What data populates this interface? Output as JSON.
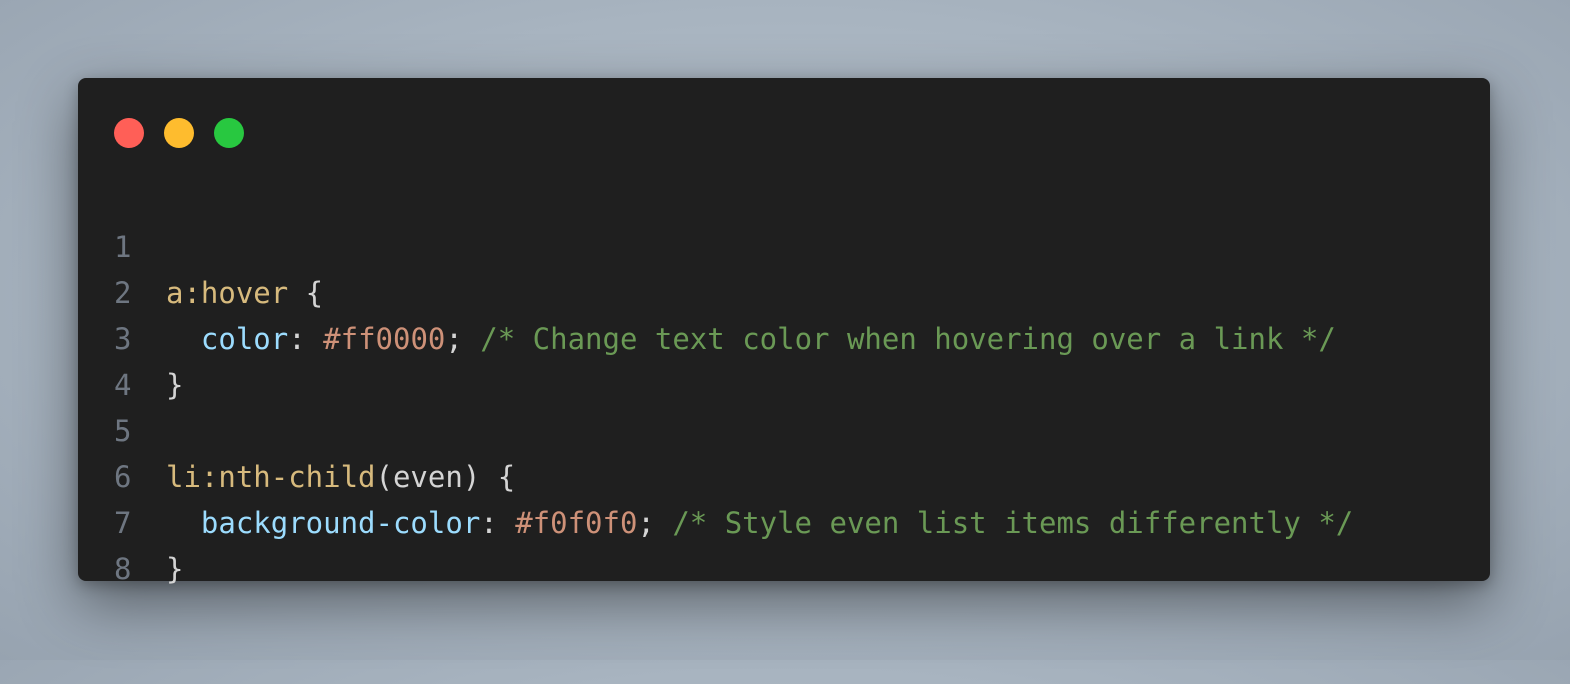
{
  "window": {
    "controls": [
      {
        "name": "close",
        "color": "#ff5f57"
      },
      {
        "name": "minimize",
        "color": "#febc2e"
      },
      {
        "name": "maximize",
        "color": "#28c840"
      }
    ]
  },
  "colors": {
    "selector": "#d7ba7d",
    "property": "#9cdcfe",
    "value": "#ce9178",
    "comment": "#6a9955",
    "punctuation": "#d4d4d4",
    "line_number": "#6e7681",
    "background": "#1f1f1f"
  },
  "code": {
    "lines": [
      {
        "num": "1",
        "selector": "a:hover",
        "brace": " {"
      },
      {
        "num": "2",
        "indent": "  ",
        "property": "color",
        "colon": ": ",
        "value": "#ff0000",
        "semi": "; ",
        "comment": "/* Change text color when hovering over a link */"
      },
      {
        "num": "3",
        "brace": "}"
      },
      {
        "num": "4"
      },
      {
        "num": "5",
        "selector": "li:nth-child",
        "args": "(even)",
        "brace": " {"
      },
      {
        "num": "6",
        "indent": "  ",
        "property": "background-color",
        "colon": ": ",
        "value": "#f0f0f0",
        "semi": "; ",
        "comment": "/* Style even list items differently */"
      },
      {
        "num": "7",
        "brace": "}"
      },
      {
        "num": "8"
      }
    ]
  }
}
